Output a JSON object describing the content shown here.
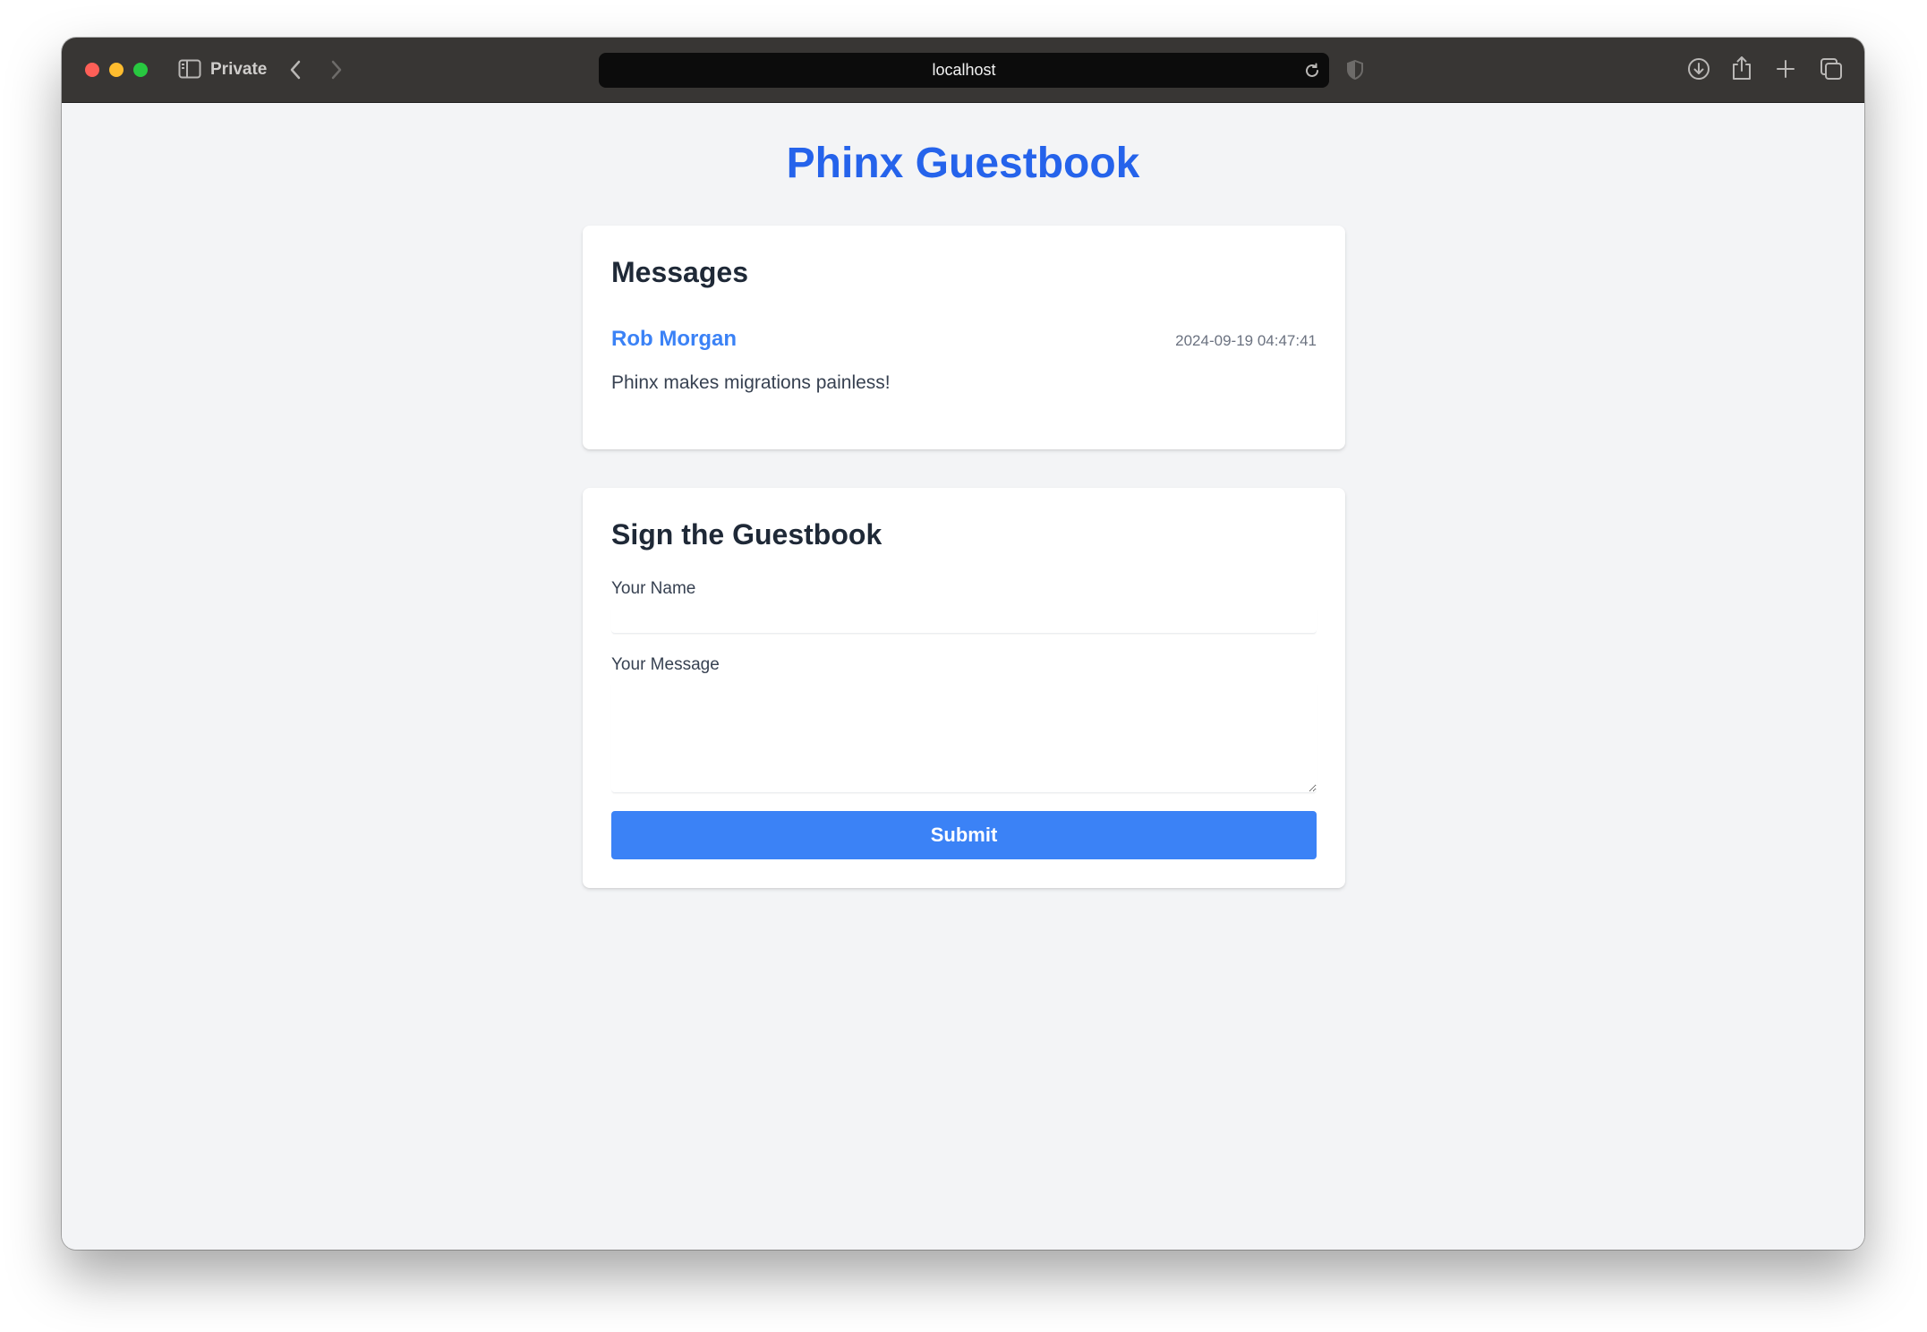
{
  "browser": {
    "private_label": "Private",
    "url": "localhost",
    "icons": {
      "sidebar": "sidebar-icon",
      "back": "chevron-left-icon",
      "forward": "chevron-right-icon",
      "reload": "reload-icon",
      "shield": "shield-icon",
      "download": "download-icon",
      "share": "share-icon",
      "new_tab": "plus-icon",
      "tab_overview": "tabs-icon"
    }
  },
  "page": {
    "title": "Phinx Guestbook"
  },
  "messages": {
    "heading": "Messages",
    "items": [
      {
        "author": "Rob Morgan",
        "timestamp": "2024-09-19 04:47:41",
        "body": "Phinx makes migrations painless!"
      }
    ]
  },
  "form": {
    "heading": "Sign the Guestbook",
    "name_label": "Your Name",
    "name_value": "",
    "message_label": "Your Message",
    "message_value": "",
    "submit_label": "Submit"
  },
  "colors": {
    "accent": "#2563eb",
    "button": "#3b82f6",
    "page_bg": "#f3f4f6"
  }
}
